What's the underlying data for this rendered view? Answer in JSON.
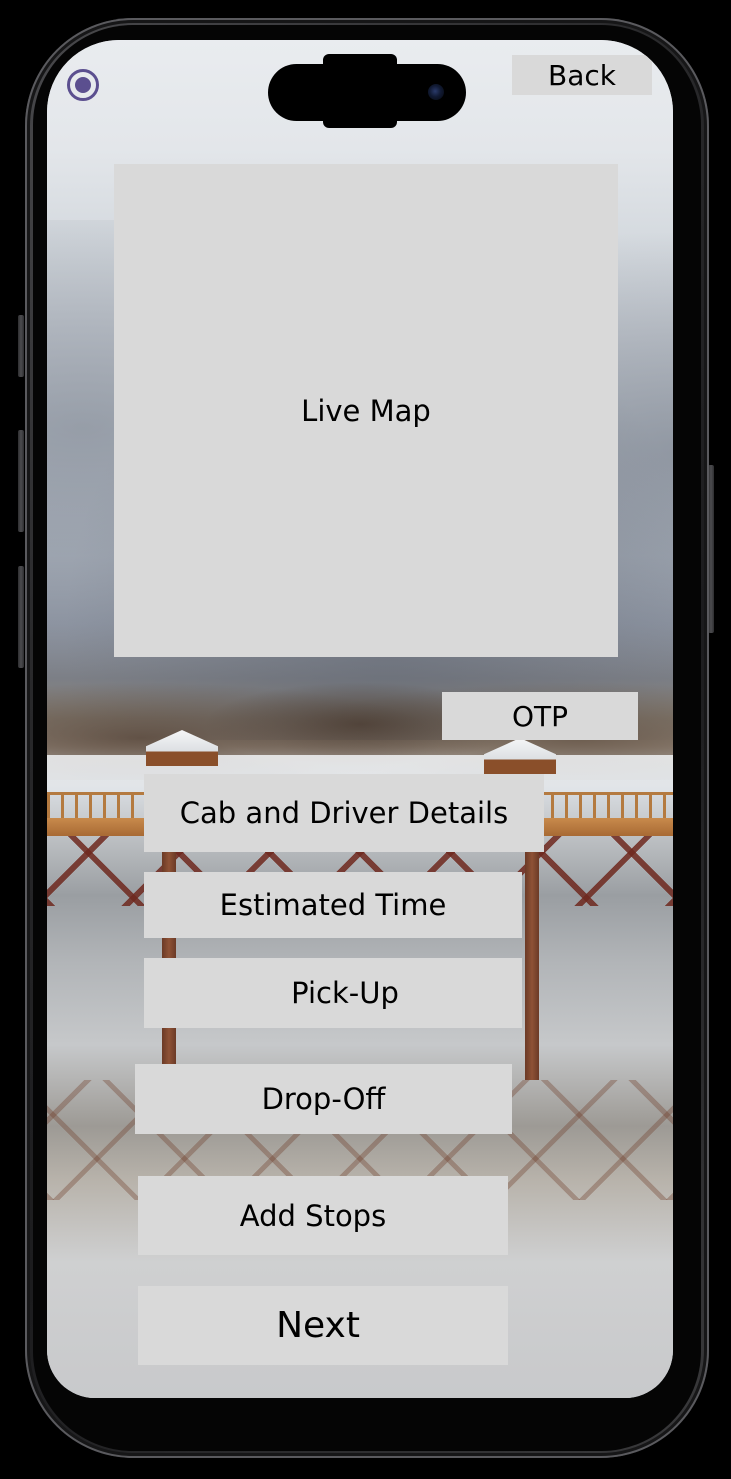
{
  "header": {
    "back_label": "Back"
  },
  "map": {
    "label": "Live Map"
  },
  "ride": {
    "otp_label": "OTP",
    "cab_details_label": "Cab and Driver Details",
    "estimated_time_label": "Estimated Time",
    "pickup_label": "Pick-Up",
    "dropoff_label": "Drop-Off",
    "add_stops_label": "Add Stops",
    "next_label": "Next"
  },
  "icons": {
    "status": "radio-selected-icon"
  },
  "colors": {
    "block_background": "#d9d9d9",
    "accent": "#5b4f8f",
    "text": "#000000"
  }
}
